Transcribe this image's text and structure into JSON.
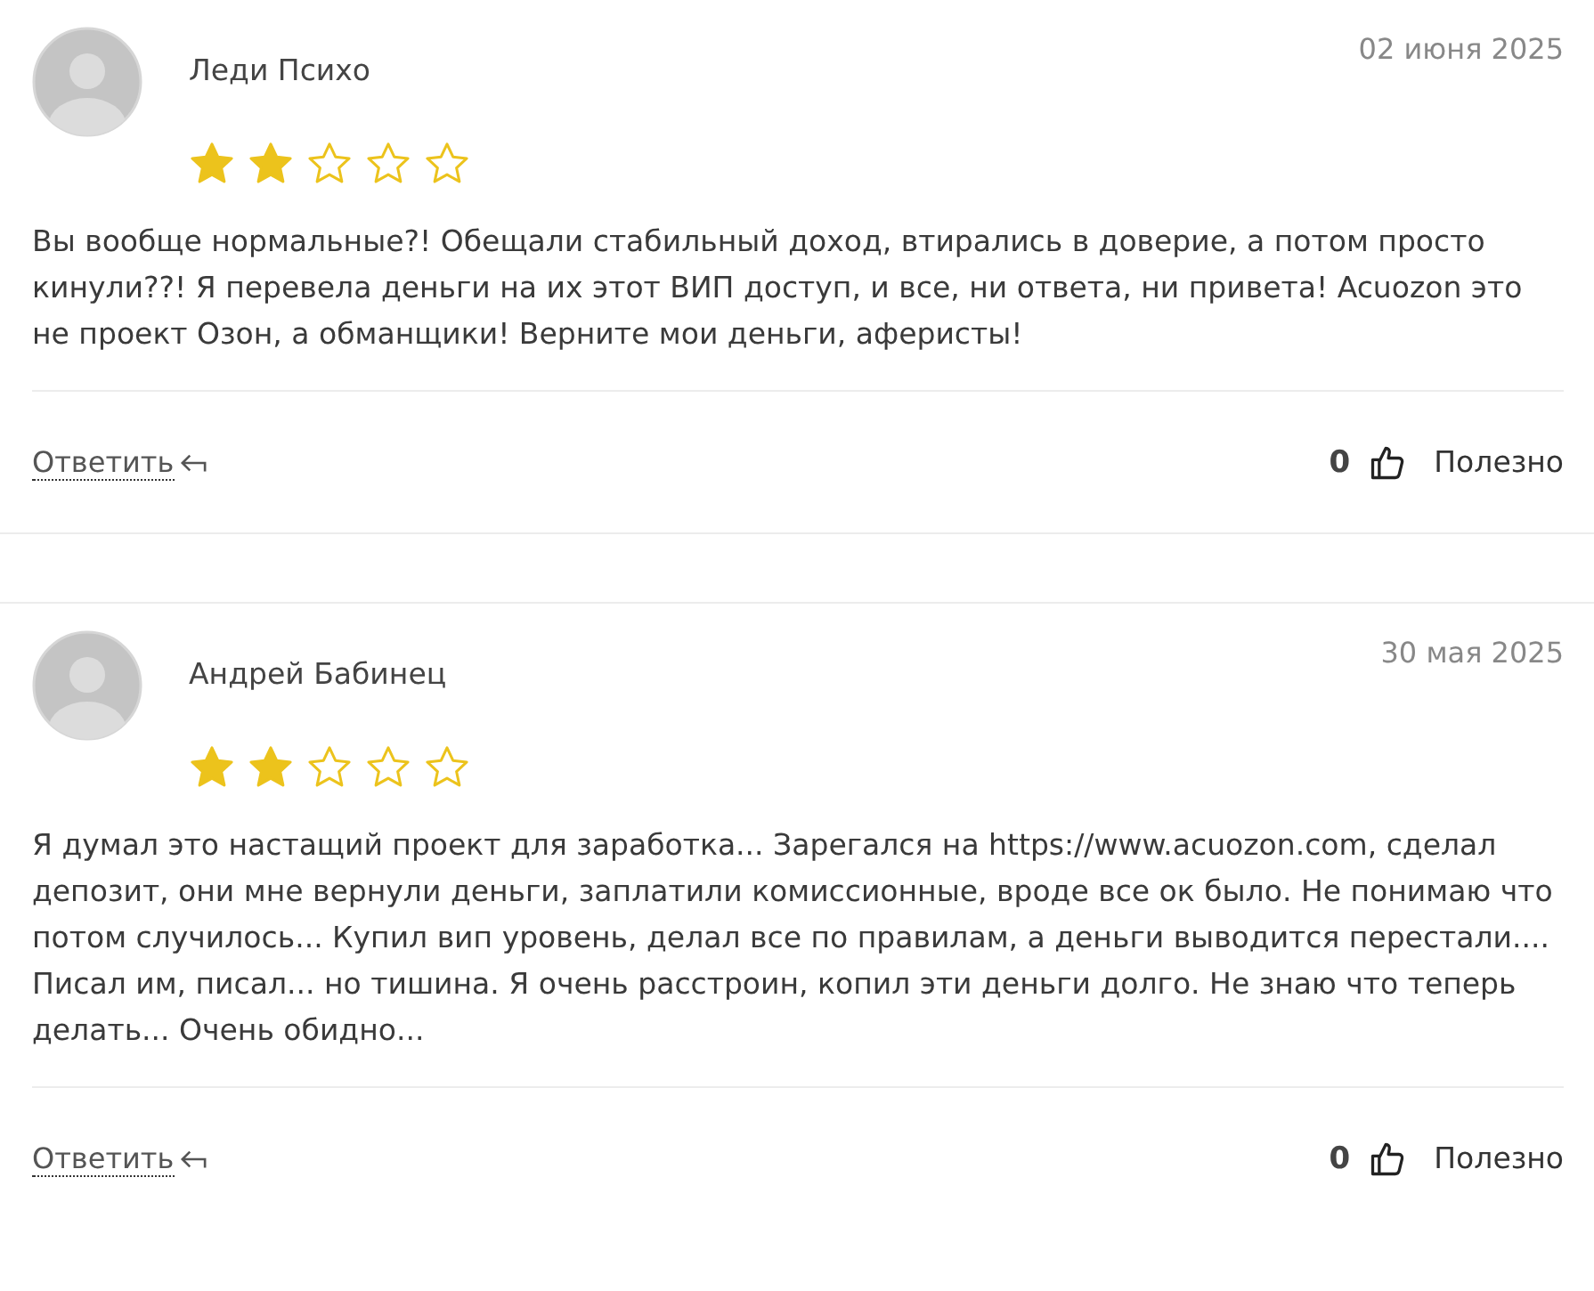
{
  "reviews": [
    {
      "author": "Леди Психо",
      "date": "02 июня 2025",
      "stars": 2,
      "text": "Вы вообще нормальные?! Обещали стабильный доход, втирались в доверие, а потом просто кинули??! Я перевела деньги на их этот ВИП доступ, и все, ни ответа, ни привета! Acuozon это не проект Озон, а обманщики! Верните мои деньги, аферисты!",
      "reply": "Ответить",
      "likes": "0",
      "useful": "Полезно"
    },
    {
      "author": "Андрей Бабинец",
      "date": "30 мая 2025",
      "stars": 2,
      "text": "Я думал это настащий проект для заработка... Зарегался на https://www.acuozon.com, сделал депозит, они мне вернули деньги, заплатили комиссионные, вроде все ок было. Не понимаю что потом случилось... Купил вип уровень, делал все по правилам, а деньги выводится перестали.... Писал им, писал... но тишина. Я очень расстроин, копил эти деньги долго. Не знаю что теперь делать... Очень обидно...",
      "reply": "Ответить",
      "likes": "0",
      "useful": "Полезно"
    }
  ]
}
